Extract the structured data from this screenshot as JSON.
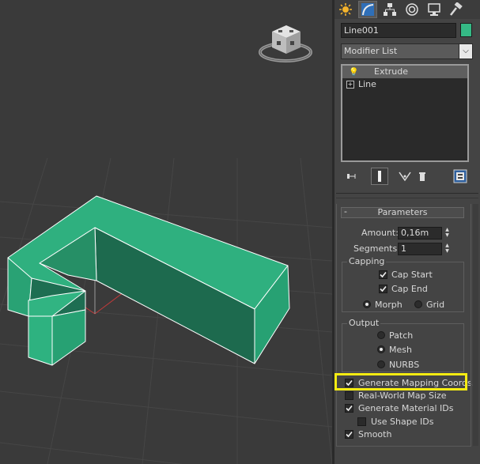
{
  "colors": {
    "object_color": "#35b985",
    "viewport_bg": "#3a3a3a",
    "highlight": "#f6ec12",
    "panel_bg": "#444444"
  },
  "command_panel": {
    "tabs": [
      {
        "name": "create-tab",
        "icon": "sun-icon"
      },
      {
        "name": "modify-tab",
        "icon": "modify-arc-icon"
      },
      {
        "name": "hierarchy-tab",
        "icon": "hierarchy-icon"
      },
      {
        "name": "motion-tab",
        "icon": "motion-icon"
      },
      {
        "name": "display-tab",
        "icon": "display-monitor-icon"
      },
      {
        "name": "utilities-tab",
        "icon": "hammer-icon"
      }
    ],
    "object_name": "Line001",
    "modifier_list_label": "Modifier List",
    "stack": [
      "Extrude",
      "Line"
    ],
    "stack_tools": [
      "pin-stack-icon",
      "show-end-result-icon",
      "make-unique-icon",
      "remove-modifier-icon",
      "configure-modifier-sets-icon"
    ]
  },
  "parameters": {
    "title": "Parameters",
    "collapse_symbol": "-",
    "amount_label": "Amount:",
    "amount_value": "0,16m",
    "segments_label": "Segments:",
    "segments_value": "1",
    "capping": {
      "title": "Capping",
      "cap_start": {
        "label": "Cap Start",
        "checked": true
      },
      "cap_end": {
        "label": "Cap End",
        "checked": true
      },
      "morph": {
        "label": "Morph",
        "selected": true
      },
      "grid": {
        "label": "Grid",
        "selected": false
      }
    },
    "output": {
      "title": "Output",
      "patch": {
        "label": "Patch",
        "selected": false
      },
      "mesh": {
        "label": "Mesh",
        "selected": true
      },
      "nurbs": {
        "label": "NURBS",
        "selected": false
      }
    },
    "generate_mapping_coords": {
      "label": "Generate Mapping Coords.",
      "checked": true
    },
    "real_world_map_size": {
      "label": "Real-World Map Size",
      "checked": false
    },
    "generate_material_ids": {
      "label": "Generate Material IDs",
      "checked": true
    },
    "use_shape_ids": {
      "label": "Use Shape IDs",
      "checked": false
    },
    "smooth": {
      "label": "Smooth",
      "checked": true
    }
  }
}
